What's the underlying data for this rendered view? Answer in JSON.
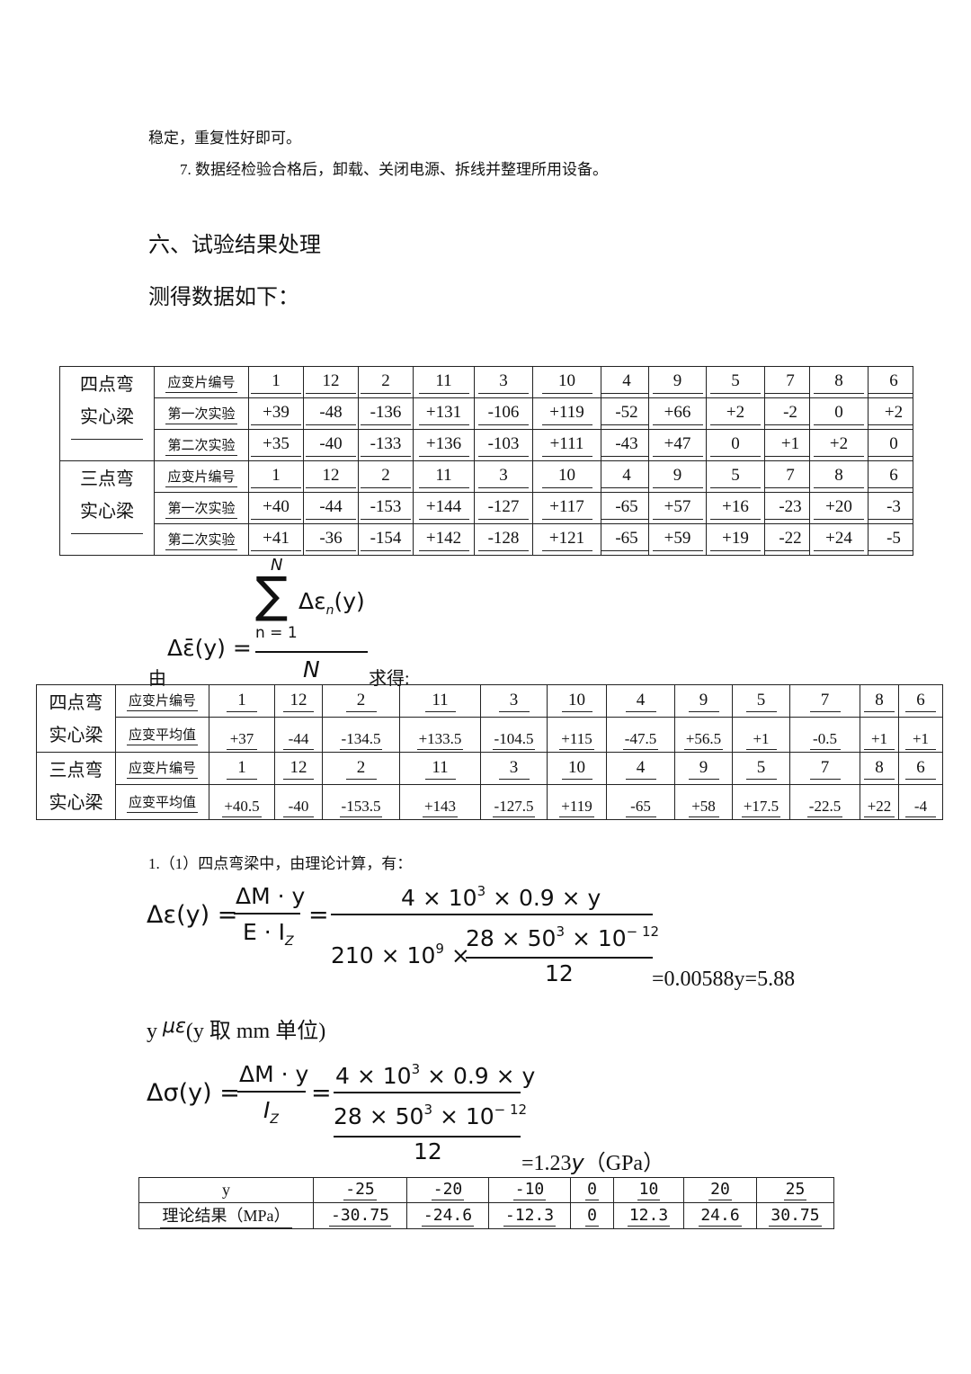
{
  "intro": {
    "line1": "稳定，重复性好即可。",
    "line2": "7.  数据经检验合格后，卸载、关闭电源、拆线并整理所用设备。"
  },
  "section_title": "六、试验结果处理",
  "measured_intro": "测得数据如下：",
  "table1": {
    "col_label": "应变片编号",
    "gauges": [
      "1",
      "12",
      "2",
      "11",
      "3",
      "10",
      "4",
      "9",
      "5",
      "7",
      "8",
      "6"
    ],
    "groups": [
      {
        "name": "四点弯实心梁",
        "name_l1": "四点弯",
        "name_l2": "实心梁",
        "rows": [
          {
            "label": "第一次实验",
            "values": [
              "+39",
              "-48",
              "-136",
              "+131",
              "-106",
              "+119",
              "-52",
              "+66",
              "+2",
              "-2",
              "0",
              "+2"
            ]
          },
          {
            "label": "第二次实验",
            "values": [
              "+35",
              "-40",
              "-133",
              "+136",
              "-103",
              "+111",
              "-43",
              "+47",
              "0",
              "+1",
              "+2",
              "0"
            ]
          }
        ]
      },
      {
        "name": "三点弯实心梁",
        "name_l1": "三点弯",
        "name_l2": "实心梁",
        "rows": [
          {
            "label": "第一次实验",
            "values": [
              "+40",
              "-44",
              "-153",
              "+144",
              "-127",
              "+117",
              "-65",
              "+57",
              "+16",
              "-23",
              "+20",
              "-3"
            ]
          },
          {
            "label": "第二次实验",
            "values": [
              "+41",
              "-36",
              "-154",
              "+142",
              "-128",
              "+121",
              "-65",
              "+59",
              "+19",
              "-22",
              "+24",
              "-5"
            ]
          }
        ]
      }
    ]
  },
  "avg_formula": {
    "prefix": "由",
    "suffix": "求得:",
    "sum_upper": "N",
    "sum_lower": "n = 1",
    "numer": "Δε",
    "numer_sub": "n",
    "numer_arg": "(y)",
    "lhs": "Δε̄(y) =",
    "denom": "N"
  },
  "table2": {
    "gauge_label": "应变片编号",
    "avg_label": "应变平均值",
    "groups": [
      {
        "name_l1": "四点弯",
        "name_l2": "实心梁",
        "gauges": [
          "1",
          "12",
          "2",
          "11",
          "3",
          "10",
          "4",
          "9",
          "5",
          "7",
          "8",
          "6"
        ],
        "averages": [
          "+37",
          "-44",
          "-134.5",
          "+133.5",
          "-104.5",
          "+115",
          "-47.5",
          "+56.5",
          "+1",
          "-0.5",
          "+1",
          "+1"
        ]
      },
      {
        "name_l1": "三点弯",
        "name_l2": "实心梁",
        "gauges": [
          "1",
          "12",
          "2",
          "11",
          "3",
          "10",
          "4",
          "9",
          "5",
          "7",
          "8",
          "6"
        ],
        "averages": [
          "+40.5",
          "-40",
          "-153.5",
          "+143",
          "-127.5",
          "+119",
          "-65",
          "+58",
          "+17.5",
          "-22.5",
          "+22",
          "-4"
        ]
      }
    ]
  },
  "calc": {
    "intro": "1.（1）四点弯梁中，由理论计算，有：",
    "eps_lhs": "Δε(y) =",
    "eps_frac_num": "ΔM · y",
    "eps_frac_den": "E · I",
    "eps_frac_den_sub": "Z",
    "eq": "=",
    "eps_big_num": "4 × 10",
    "eps_big_num_exp": "3",
    "eps_big_num_rest": " × 0.9 × y",
    "eps_den_a": "210 × 10",
    "eps_den_a_exp": "9",
    "eps_den_a_rest": " ×",
    "inner_num": "28 × 50",
    "inner_num_exp": "3",
    "inner_num_rest": " × 10",
    "inner_num_exp2": "− 12",
    "inner_den": "12",
    "eps_result": "=0.00588y=5.88",
    "eps_unit_y": "y",
    "eps_unit_mu": "με",
    "eps_unit_note": "(y 取 mm 单位)",
    "sig_lhs": "Δσ(y) =",
    "sig_frac_num": "ΔM · y",
    "sig_frac_den": "I",
    "sig_frac_den_sub": "Z",
    "sig_result_pre": "=1.23",
    "sig_result_var": "y",
    "sig_result_unit": "（GPa）"
  },
  "table3": {
    "header_label": "y",
    "row_label": "理论结果（MPa）",
    "y": [
      "-25",
      "-20",
      "-10",
      "0",
      "10",
      "20",
      "25"
    ],
    "values": [
      "-30.75",
      "-24.6",
      "-12.3",
      "0",
      "12.3",
      "24.6",
      "30.75"
    ]
  }
}
